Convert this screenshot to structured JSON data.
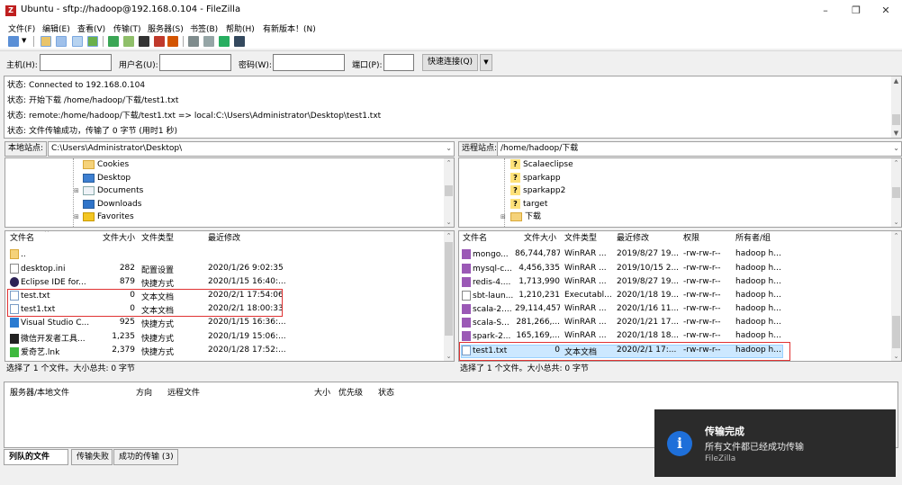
{
  "window": {
    "title": "Ubuntu - sftp://hadoop@192.168.0.104 - FileZilla",
    "app_icon": "Z",
    "minimize": "–",
    "maximize": "❐",
    "close": "✕"
  },
  "menu": [
    "文件(F)",
    "编辑(E)",
    "查看(V)",
    "传输(T)",
    "服务器(S)",
    "书签(B)",
    "帮助(H)",
    "有新版本！(N)"
  ],
  "quickconnect": {
    "host_label": "主机(H):",
    "user_label": "用户名(U):",
    "pass_label": "密码(W):",
    "port_label": "端口(P):",
    "host_value": "",
    "user_value": "",
    "pass_value": "",
    "port_value": "",
    "button": "快速连接(Q)",
    "dropdown": "▼"
  },
  "log": [
    {
      "label": "状态:",
      "text": "Connected to 192.168.0.104"
    },
    {
      "label": "状态:",
      "text": "开始下载 /home/hadoop/下载/test1.txt"
    },
    {
      "label": "状态:",
      "text": "remote:/home/hadoop/下载/test1.txt => local:C:\\Users\\Administrator\\Desktop\\test1.txt"
    },
    {
      "label": "状态:",
      "text": "文件传输成功，传输了 0 字节 (用时1 秒)"
    }
  ],
  "local": {
    "site_label": "本地站点:",
    "path": "C:\\Users\\Administrator\\Desktop\\",
    "tree": [
      "Cookies",
      "Desktop",
      "Documents",
      "Downloads",
      "Favorites"
    ],
    "columns": [
      "文件名",
      "文件大小",
      "文件类型",
      "最近修改"
    ],
    "files": [
      {
        "name": "..",
        "size": "",
        "type": "",
        "modified": ""
      },
      {
        "name": "desktop.ini",
        "size": "282",
        "type": "配置设置",
        "modified": "2020/1/26 9:02:35"
      },
      {
        "name": "Eclipse IDE for...",
        "size": "879",
        "type": "快捷方式",
        "modified": "2020/1/15 16:40:..."
      },
      {
        "name": "test.txt",
        "size": "0",
        "type": "文本文档",
        "modified": "2020/2/1 17:54:06"
      },
      {
        "name": "test1.txt",
        "size": "0",
        "type": "文本文档",
        "modified": "2020/2/1 18:00:33"
      },
      {
        "name": "Visual Studio C...",
        "size": "925",
        "type": "快捷方式",
        "modified": "2020/1/15 16:36:..."
      },
      {
        "name": "微信开发者工具...",
        "size": "1,235",
        "type": "快捷方式",
        "modified": "2020/1/19 15:06:..."
      },
      {
        "name": "爱奇艺.lnk",
        "size": "2,379",
        "type": "快捷方式",
        "modified": "2020/1/28 17:52:..."
      }
    ],
    "status": "选择了 1 个文件。大小总共: 0 字节"
  },
  "remote": {
    "site_label": "远程站点:",
    "path": "/home/hadoop/下载",
    "tree": [
      "Scalaeclipse",
      "sparkapp",
      "sparkapp2",
      "target",
      "下载"
    ],
    "columns": [
      "文件名",
      "文件大小",
      "文件类型",
      "最近修改",
      "权限",
      "所有者/组"
    ],
    "files": [
      {
        "name": "mongo...",
        "size": "86,744,787",
        "type": "WinRAR ...",
        "modified": "2019/8/27 19...",
        "perm": "-rw-rw-r--",
        "owner": "hadoop h..."
      },
      {
        "name": "mysql-c...",
        "size": "4,456,335",
        "type": "WinRAR ...",
        "modified": "2019/10/15 2...",
        "perm": "-rw-rw-r--",
        "owner": "hadoop h..."
      },
      {
        "name": "redis-4....",
        "size": "1,713,990",
        "type": "WinRAR ...",
        "modified": "2019/8/27 19...",
        "perm": "-rw-rw-r--",
        "owner": "hadoop h..."
      },
      {
        "name": "sbt-laun...",
        "size": "1,210,231",
        "type": "Executabl...",
        "modified": "2020/1/18 19...",
        "perm": "-rw-rw-r--",
        "owner": "hadoop h..."
      },
      {
        "name": "scala-2....",
        "size": "29,114,457",
        "type": "WinRAR ...",
        "modified": "2020/1/16 11...",
        "perm": "-rw-rw-r--",
        "owner": "hadoop h..."
      },
      {
        "name": "scala-S...",
        "size": "281,266,...",
        "type": "WinRAR ...",
        "modified": "2020/1/21 17...",
        "perm": "-rw-rw-r--",
        "owner": "hadoop h..."
      },
      {
        "name": "spark-2...",
        "size": "165,169,...",
        "type": "WinRAR ...",
        "modified": "2020/1/18 18...",
        "perm": "-rw-rw-r--",
        "owner": "hadoop h..."
      },
      {
        "name": "test1.txt",
        "size": "0",
        "type": "文本文档",
        "modified": "2020/2/1 17:...",
        "perm": "-rw-rw-r--",
        "owner": "hadoop h..."
      }
    ],
    "status": "选择了 1 个文件。大小总共: 0 字节"
  },
  "queue": {
    "columns": [
      "服务器/本地文件",
      "方向",
      "远程文件",
      "大小",
      "优先级",
      "状态"
    ],
    "tabs": [
      "列队的文件",
      "传输失败",
      "成功的传输 (3)"
    ]
  },
  "toast": {
    "icon": "i",
    "title": "传输完成",
    "message": "所有文件都已经成功传输",
    "app": "FileZilla"
  }
}
